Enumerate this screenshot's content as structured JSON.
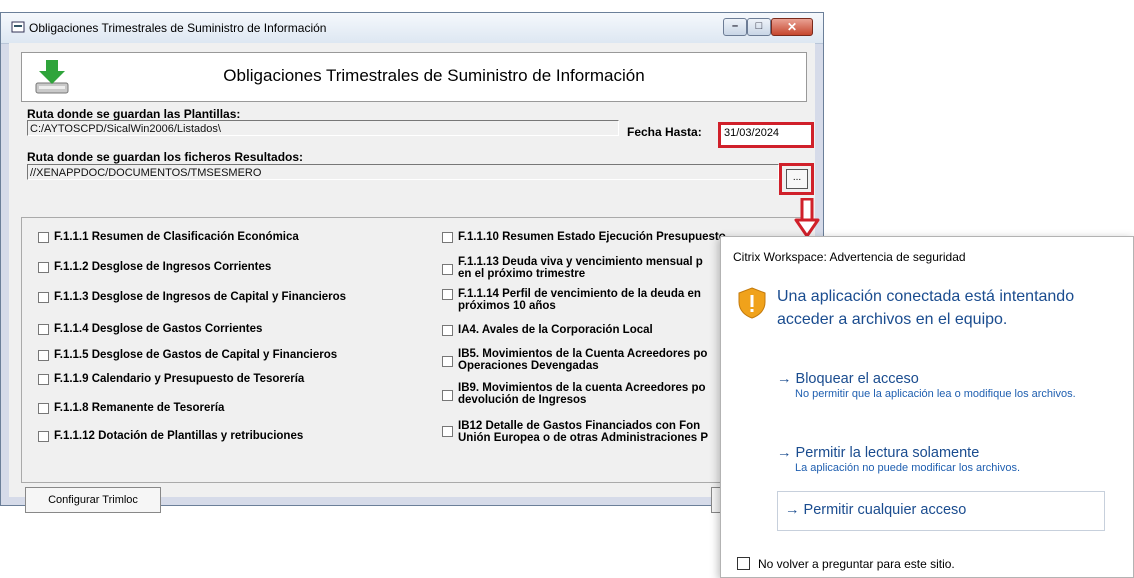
{
  "window": {
    "title": "Obligaciones Trimestrales de Suministro de Información",
    "controls": {
      "minimize": "–",
      "maximize": "□",
      "close": "✕"
    }
  },
  "header": {
    "title": "Obligaciones Trimestrales de Suministro de Información"
  },
  "paths": {
    "plantillas_label": "Ruta donde se guardan las Plantillas:",
    "plantillas_value": "C:/AYTOSCPD/SicalWin2006/Listados\\",
    "resultados_label": "Ruta donde se guardan los ficheros Resultados:",
    "resultados_value": "//XENAPPDOC/DOCUMENTOS/TMSESMERO",
    "browse_label": "..."
  },
  "fecha": {
    "label": "Fecha Hasta:",
    "value": "31/03/2024"
  },
  "checks_left": [
    "F.1.1.1 Resumen de Clasificación Económica",
    "F.1.1.2 Desglose de Ingresos Corrientes",
    "F.1.1.3 Desglose de Ingresos de Capital y Financieros",
    "F.1.1.4 Desglose de Gastos Corrientes",
    "F.1.1.5 Desglose de Gastos de Capital y Financieros",
    "F.1.1.9 Calendario y Presupuesto de Tesorería",
    "F.1.1.8 Remanente de Tesorería",
    "F.1.1.12 Dotación de Plantillas y retribuciones"
  ],
  "checks_right": [
    {
      "l1": "F.1.1.10 Resumen Estado Ejecución Presupuesto",
      "l2": ""
    },
    {
      "l1": "F.1.1.13 Deuda viva y vencimiento mensual p",
      "l2": "en el próximo trimestre"
    },
    {
      "l1": "F.1.1.14 Perfil de vencimiento de la deuda en",
      "l2": "próximos 10 años"
    },
    {
      "l1": "IA4. Avales de la Corporación Local",
      "l2": ""
    },
    {
      "l1": "IB5. Movimientos de la Cuenta Acreedores po",
      "l2": "Operaciones Devengadas"
    },
    {
      "l1": "IB9. Movimientos de la cuenta Acreedores po",
      "l2": "devolución de Ingresos"
    },
    {
      "l1": "IB12 Detalle de Gastos Financiados con Fon",
      "l2": "Unión Europea o de otras Administraciones P"
    }
  ],
  "buttons": {
    "configurar": "Configurar Trimloc"
  },
  "dialog": {
    "title": "Citrix Workspace: Advertencia de seguridad",
    "message": "Una aplicación conectada está intentando acceder a archivos en el equipo.",
    "options": [
      {
        "label": "Bloquear el acceso",
        "desc": "No permitir que la aplicación lea o modifique los archivos."
      },
      {
        "label": "Permitir la lectura solamente",
        "desc": "La aplicación no puede modificar los archivos."
      },
      {
        "label": "Permitir cualquier acceso",
        "desc": ""
      }
    ],
    "arrow": "→",
    "dont_ask": "No volver a preguntar para este sitio."
  },
  "colors": {
    "highlight": "#d0202a",
    "dialog_link": "#1a4c8f"
  }
}
